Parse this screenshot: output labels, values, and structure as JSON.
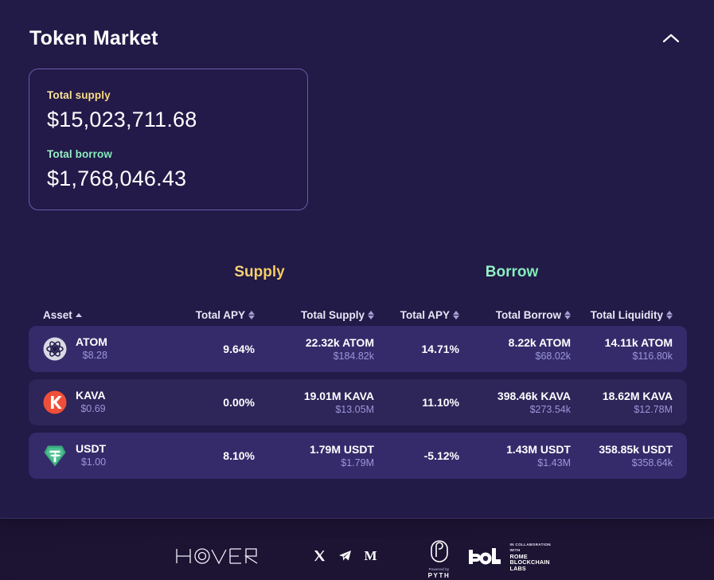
{
  "panel": {
    "title": "Token Market",
    "collapse_icon": "chevron-up-icon"
  },
  "stats": {
    "supply_label": "Total supply",
    "supply_value": "$15,023,711.68",
    "borrow_label": "Total borrow",
    "borrow_value": "$1,768,046.43"
  },
  "sections": {
    "supply": "Supply",
    "borrow": "Borrow"
  },
  "table": {
    "headers": {
      "asset": "Asset",
      "supply_apy": "Total APY",
      "total_supply": "Total Supply",
      "borrow_apy": "Total APY",
      "total_borrow": "Total Borrow",
      "total_liquidity": "Total Liquidity"
    },
    "rows": [
      {
        "icon": "atom-coin-icon",
        "name": "ATOM",
        "price": "$8.28",
        "supply_apy": "9.64%",
        "supply_amount": "22.32k ATOM",
        "supply_usd": "$184.82k",
        "borrow_apy": "14.71%",
        "borrow_amount": "8.22k ATOM",
        "borrow_usd": "$68.02k",
        "liquidity_amount": "14.11k ATOM",
        "liquidity_usd": "$116.80k"
      },
      {
        "icon": "kava-coin-icon",
        "name": "KAVA",
        "price": "$0.69",
        "supply_apy": "0.00%",
        "supply_amount": "19.01M KAVA",
        "supply_usd": "$13.05M",
        "borrow_apy": "11.10%",
        "borrow_amount": "398.46k KAVA",
        "borrow_usd": "$273.54k",
        "liquidity_amount": "18.62M KAVA",
        "liquidity_usd": "$12.78M"
      },
      {
        "icon": "usdt-coin-icon",
        "name": "USDT",
        "price": "$1.00",
        "supply_apy": "8.10%",
        "supply_amount": "1.79M USDT",
        "supply_usd": "$1.79M",
        "borrow_apy": "-5.12%",
        "borrow_amount": "1.43M USDT",
        "borrow_usd": "$1.43M",
        "liquidity_amount": "358.85k USDT",
        "liquidity_usd": "$358.64k"
      }
    ]
  },
  "footer": {
    "brand": "HOVER",
    "social_x": "x-twitter-icon",
    "social_telegram": "telegram-icon",
    "social_medium": "M",
    "pyth_powered_by": "Powered by",
    "pyth_name": "PYTH",
    "rbl_collab": "IN COLLABORATION WITH",
    "rbl_line1": "ROME",
    "rbl_line2": "BLOCKCHAIN",
    "rbl_line3": "LABS"
  },
  "colors": {
    "panel_bg": "#221a47",
    "row_odd": "#352b6b",
    "row_even": "#2e2559",
    "supply_accent": "#f6cd63",
    "borrow_accent": "#84eebc",
    "muted_text": "#9c96d8"
  }
}
